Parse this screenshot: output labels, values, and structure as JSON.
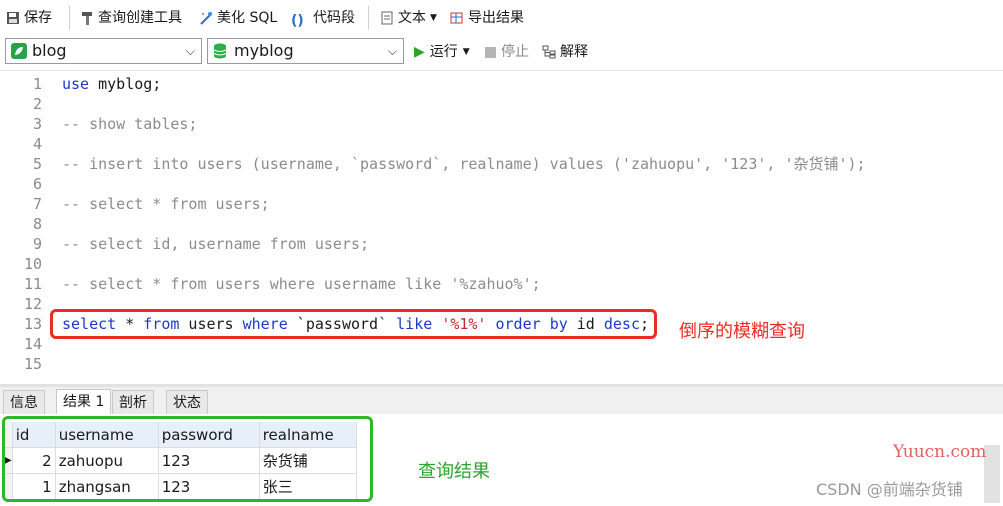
{
  "toolbar": {
    "save": "保存",
    "query_builder": "查询创建工具",
    "beautify_sql": "美化 SQL",
    "code_snippet": "代码段",
    "text": "文本",
    "export_results": "导出结果",
    "connection": "blog",
    "database": "myblog",
    "run": "运行",
    "stop": "停止",
    "explain": "解释"
  },
  "editor": {
    "line_numbers": [
      "1",
      "2",
      "3",
      "4",
      "5",
      "6",
      "7",
      "8",
      "9",
      "10",
      "11",
      "12",
      "13",
      "14",
      "15"
    ],
    "lines": [
      {
        "kw1": "use",
        "rest": " myblog;"
      },
      {
        "text": ""
      },
      {
        "comment": "-- show tables;"
      },
      {
        "text": ""
      },
      {
        "comment": "-- insert into users (username, `password`, realname) values ('zahuopu', '123', '杂货铺');"
      },
      {
        "text": ""
      },
      {
        "comment": "-- select * from users;"
      },
      {
        "text": ""
      },
      {
        "comment": "-- select id, username from users;"
      },
      {
        "text": ""
      },
      {
        "comment": "-- select * from users where username like '%zahuo%';"
      },
      {
        "text": ""
      },
      {
        "q_select": "select",
        "q_star": " * ",
        "q_from": "from",
        "q_users": " users ",
        "q_where": "where",
        "q_pw": " `password` ",
        "q_like": "like",
        "q_sp1": " ",
        "q_str": "'%1%'",
        "q_sp2": " ",
        "q_order": "order",
        "q_sp3": " ",
        "q_by": "by",
        "q_id": " id ",
        "q_desc": "desc",
        "q_semi": ";"
      },
      {
        "text": ""
      },
      {
        "text": ""
      }
    ],
    "annotation": "倒序的模糊查询"
  },
  "tabs": [
    "信息",
    "结果 1",
    "剖析",
    "状态"
  ],
  "results": {
    "columns": [
      "id",
      "username",
      "password",
      "realname"
    ],
    "rows": [
      [
        "2",
        "zahuopu",
        "123",
        "杂货铺"
      ],
      [
        "1",
        "zhangsan",
        "123",
        "张三"
      ]
    ],
    "annotation": "查询结果"
  },
  "watermarks": [
    "Yuucn.com",
    "CSDN @前端杂货铺"
  ],
  "colors": {
    "keyword": "#1c39c8",
    "comment": "#8c8c8c",
    "string": "#c8282e",
    "red_box": "#ee2a24",
    "green_box": "#2db72d"
  }
}
